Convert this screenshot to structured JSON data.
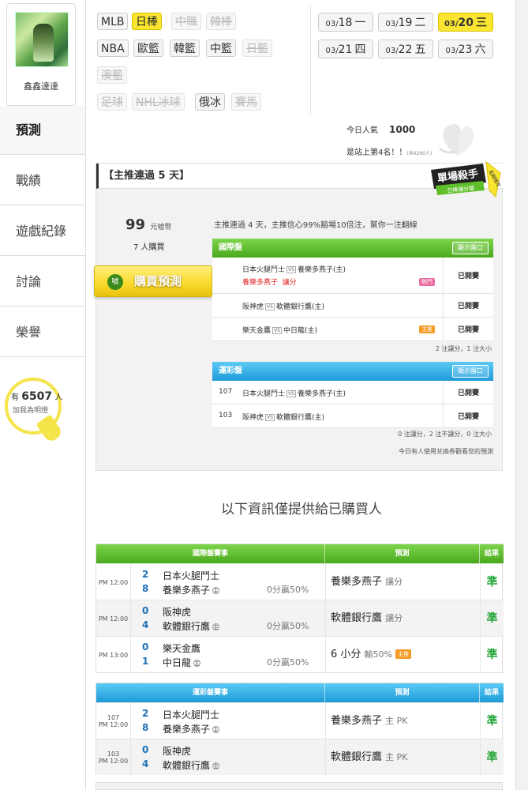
{
  "user": {
    "name": "鑫鑫達達"
  },
  "nav": [
    "預測",
    "戰績",
    "遊戲紀錄",
    "討論",
    "榮譽"
  ],
  "fans": {
    "prefix": "有",
    "count": "6507",
    "unit": "人",
    "cta": "加我為明燈"
  },
  "sports_row1": [
    {
      "label": "MLB",
      "state": "normal"
    },
    {
      "label": "日棒",
      "state": "selected"
    },
    {
      "label": "中職",
      "state": "disabled"
    },
    {
      "label": "韓棒",
      "state": "disabled"
    }
  ],
  "sports_row2": [
    {
      "label": "NBA",
      "state": "normal"
    },
    {
      "label": "歐籃",
      "state": "normal"
    },
    {
      "label": "韓籃",
      "state": "normal"
    },
    {
      "label": "中籃",
      "state": "normal"
    },
    {
      "label": "日籃",
      "state": "disabled"
    }
  ],
  "sports_row3": [
    {
      "label": "澳籃",
      "state": "disabled"
    }
  ],
  "sports_row4": [
    {
      "label": "足球",
      "state": "disabled"
    },
    {
      "label": "NHL冰球",
      "state": "disabled"
    },
    {
      "label": "俄冰",
      "state": "normal"
    },
    {
      "label": "賽馬",
      "state": "disabled"
    }
  ],
  "dates": [
    {
      "date": "03/",
      "day": "18",
      "wd": "一",
      "state": "normal"
    },
    {
      "date": "03/",
      "day": "19",
      "wd": "二",
      "state": "normal"
    },
    {
      "date": "03/",
      "day": "20",
      "wd": "三",
      "state": "selected"
    },
    {
      "date": "03/",
      "day": "21",
      "wd": "四",
      "state": "normal"
    },
    {
      "date": "03/",
      "day": "22",
      "wd": "五",
      "state": "normal"
    },
    {
      "date": "03/",
      "day": "23",
      "wd": "六",
      "state": "normal"
    }
  ],
  "popularity": {
    "label": "今日人氣",
    "value": "1000",
    "rank_text": "是站上第4名！！",
    "rank_note": "(共6290人)"
  },
  "panel": {
    "title": "【主推連過 5 天】",
    "badge_main": "單場殺手",
    "badge_sub": "日棒讓分盤",
    "badge_ribbon": "長期穩定",
    "price": "99",
    "price_unit": "元嘘幣",
    "buyers": "7 人購買",
    "buy_label": "購買預測",
    "buy_icon": "嘘",
    "intro": "主推連過 4 天，主推信心99%豁場10倍注，幫你一注翻線"
  },
  "intl": {
    "title": "國際盤",
    "btn": "顯示盤口",
    "rows": [
      {
        "home": "日本火腿鬥士",
        "away": "養樂多燕子(主)",
        "pick_team": "養樂多燕子",
        "pick_type": "讓分",
        "chip": "熱門",
        "status": "已開賽"
      },
      {
        "home": "阪神虎",
        "away": "軟體銀行鷹(主)",
        "status": "已開賽"
      },
      {
        "home": "樂天金鷹",
        "away": "中日龍(主)",
        "chip": "主推",
        "status": "已開賽"
      }
    ],
    "summary": "2 注讓分，1 注大小"
  },
  "lottery": {
    "title": "運彩盤",
    "btn": "顯示盤口",
    "rows": [
      {
        "no": "107",
        "home": "日本火腿鬥士",
        "away": "養樂多燕子(主)",
        "status": "已開賽"
      },
      {
        "no": "103",
        "home": "阪神虎",
        "away": "軟體銀行鷹(主)",
        "status": "已開賽"
      }
    ],
    "summary": "0 注讓分，2 注不讓分，0 注大小",
    "voucher_note": "今日有人使用兌換券觀看您的預測"
  },
  "info_title": "以下資訊僅提供給已購買人",
  "table_intl": {
    "headers": [
      "國際盤賽事",
      "預測",
      "結果"
    ],
    "rows": [
      {
        "time": "PM 12:00",
        "s1": "2",
        "t1": "日本火腿鬥士",
        "s2": "8",
        "t2": "養樂多燕子",
        "odds": "0分贏50%",
        "pred": "養樂多燕子",
        "pred_sub": "讓分",
        "res": "準"
      },
      {
        "time": "PM 12:00",
        "s1": "0",
        "t1": "阪神虎",
        "s2": "4",
        "t2": "軟體銀行鷹",
        "odds": "0分贏50%",
        "pred": "軟體銀行鷹",
        "pred_sub": "讓分",
        "res": "準"
      },
      {
        "time": "PM 13:00",
        "s1": "0",
        "t1": "樂天金鷹",
        "s2": "1",
        "t2": "中日龍",
        "odds": "0分贏50%",
        "pred": "6 小分",
        "pred_sub": "輸50%",
        "chip": "主推",
        "res": "準"
      }
    ]
  },
  "table_lottery": {
    "headers": [
      "運彩盤賽事",
      "預測",
      "結果"
    ],
    "rows": [
      {
        "no": "107",
        "time": "PM 12:00",
        "s1": "2",
        "t1": "日本火腿鬥士",
        "s2": "8",
        "t2": "養樂多燕子",
        "pred": "養樂多燕子",
        "pred_sub": "主 PK",
        "res": "準"
      },
      {
        "no": "103",
        "time": "PM 12:00",
        "s1": "0",
        "t1": "阪神虎",
        "s2": "4",
        "t2": "軟體銀行鷹",
        "pred": "軟體銀行鷹",
        "pred_sub": "主 PK",
        "res": "準"
      }
    ]
  },
  "home_mark": "主",
  "vs_mark": "VS",
  "colors": {
    "accent_yellow": "#fae631",
    "green": "#49a91e",
    "blue": "#1d9ad8",
    "correct": "#26a63a"
  }
}
